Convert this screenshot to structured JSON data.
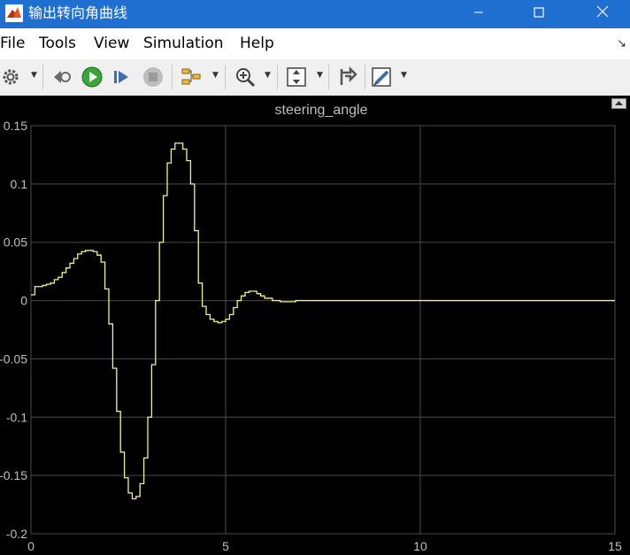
{
  "window": {
    "title": "输出转向角曲线"
  },
  "menu": {
    "items": [
      "File",
      "Tools",
      "View",
      "Simulation",
      "Help"
    ]
  },
  "toolbar": {
    "buttons": [
      "settings",
      "step-back",
      "run",
      "step-forward",
      "stop",
      "signal-selector",
      "zoom",
      "autoscale",
      "signal-hierarchy",
      "style"
    ]
  },
  "colors": {
    "titlebar": "#1f6fd1",
    "trace": "#f2f28a",
    "background": "#000000",
    "grid": "#555555"
  },
  "chart_data": {
    "type": "line",
    "title": "steering_angle",
    "xlabel": "",
    "ylabel": "",
    "xlim": [
      0,
      15
    ],
    "ylim": [
      -0.2,
      0.15
    ],
    "grid": true,
    "xticks": [
      0,
      5,
      10,
      15
    ],
    "yticks": [
      -0.2,
      -0.15,
      -0.1,
      -0.05,
      0,
      0.05,
      0.1,
      0.15
    ],
    "xtick_labels": [
      "0",
      "5",
      "10",
      "15"
    ],
    "ytick_labels": [
      "-0.2",
      "-0.15",
      "-0.1",
      "-0.05",
      "0",
      "0.05",
      "0.1",
      "0.15"
    ],
    "series": [
      {
        "step": true,
        "x": [
          0,
          0.1,
          0.2,
          0.3,
          0.4,
          0.5,
          0.6,
          0.7,
          0.8,
          0.9,
          1.0,
          1.1,
          1.2,
          1.3,
          1.4,
          1.5,
          1.6,
          1.7,
          1.8,
          1.9,
          2.0,
          2.1,
          2.2,
          2.3,
          2.4,
          2.5,
          2.6,
          2.7,
          2.8,
          2.9,
          3.0,
          3.1,
          3.2,
          3.3,
          3.4,
          3.5,
          3.6,
          3.7,
          3.8,
          3.9,
          4.0,
          4.1,
          4.2,
          4.3,
          4.4,
          4.5,
          4.6,
          4.7,
          4.8,
          4.9,
          5.0,
          5.1,
          5.2,
          5.3,
          5.4,
          5.5,
          5.6,
          5.7,
          5.8,
          5.9,
          6.0,
          6.2,
          6.4,
          6.6,
          6.8,
          7.0,
          7.5,
          8.0,
          15.0
        ],
        "y": [
          0.005,
          0.012,
          0.012,
          0.013,
          0.014,
          0.015,
          0.018,
          0.02,
          0.024,
          0.028,
          0.032,
          0.036,
          0.04,
          0.042,
          0.043,
          0.043,
          0.042,
          0.039,
          0.033,
          0.01,
          -0.02,
          -0.058,
          -0.095,
          -0.13,
          -0.152,
          -0.165,
          -0.17,
          -0.168,
          -0.157,
          -0.135,
          -0.1,
          -0.055,
          0.0,
          0.05,
          0.09,
          0.118,
          0.13,
          0.135,
          0.135,
          0.13,
          0.12,
          0.1,
          0.06,
          0.015,
          -0.005,
          -0.012,
          -0.016,
          -0.018,
          -0.019,
          -0.018,
          -0.016,
          -0.012,
          -0.006,
          0.0,
          0.004,
          0.007,
          0.008,
          0.008,
          0.006,
          0.004,
          0.002,
          0.0,
          -0.001,
          -0.001,
          0.0,
          0.0,
          0.0,
          0.0,
          0.0
        ]
      }
    ]
  }
}
